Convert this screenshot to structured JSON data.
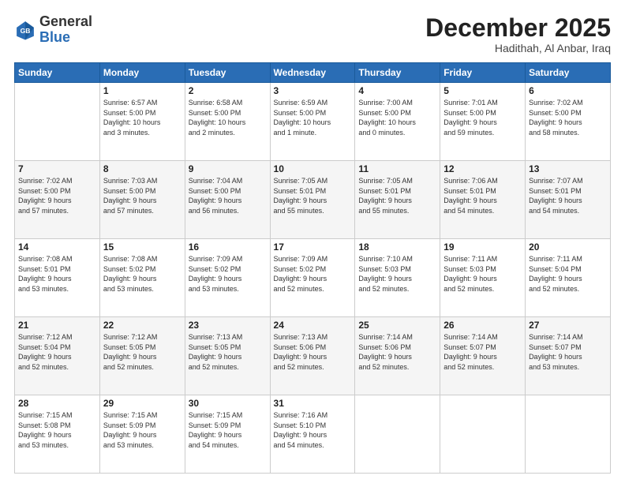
{
  "header": {
    "logo": {
      "line1": "General",
      "line2": "Blue"
    },
    "title": "December 2025",
    "location": "Hadithah, Al Anbar, Iraq"
  },
  "weekdays": [
    "Sunday",
    "Monday",
    "Tuesday",
    "Wednesday",
    "Thursday",
    "Friday",
    "Saturday"
  ],
  "weeks": [
    [
      {
        "day": "",
        "info": ""
      },
      {
        "day": "1",
        "info": "Sunrise: 6:57 AM\nSunset: 5:00 PM\nDaylight: 10 hours\nand 3 minutes."
      },
      {
        "day": "2",
        "info": "Sunrise: 6:58 AM\nSunset: 5:00 PM\nDaylight: 10 hours\nand 2 minutes."
      },
      {
        "day": "3",
        "info": "Sunrise: 6:59 AM\nSunset: 5:00 PM\nDaylight: 10 hours\nand 1 minute."
      },
      {
        "day": "4",
        "info": "Sunrise: 7:00 AM\nSunset: 5:00 PM\nDaylight: 10 hours\nand 0 minutes."
      },
      {
        "day": "5",
        "info": "Sunrise: 7:01 AM\nSunset: 5:00 PM\nDaylight: 9 hours\nand 59 minutes."
      },
      {
        "day": "6",
        "info": "Sunrise: 7:02 AM\nSunset: 5:00 PM\nDaylight: 9 hours\nand 58 minutes."
      }
    ],
    [
      {
        "day": "7",
        "info": "Sunrise: 7:02 AM\nSunset: 5:00 PM\nDaylight: 9 hours\nand 57 minutes."
      },
      {
        "day": "8",
        "info": "Sunrise: 7:03 AM\nSunset: 5:00 PM\nDaylight: 9 hours\nand 57 minutes."
      },
      {
        "day": "9",
        "info": "Sunrise: 7:04 AM\nSunset: 5:00 PM\nDaylight: 9 hours\nand 56 minutes."
      },
      {
        "day": "10",
        "info": "Sunrise: 7:05 AM\nSunset: 5:01 PM\nDaylight: 9 hours\nand 55 minutes."
      },
      {
        "day": "11",
        "info": "Sunrise: 7:05 AM\nSunset: 5:01 PM\nDaylight: 9 hours\nand 55 minutes."
      },
      {
        "day": "12",
        "info": "Sunrise: 7:06 AM\nSunset: 5:01 PM\nDaylight: 9 hours\nand 54 minutes."
      },
      {
        "day": "13",
        "info": "Sunrise: 7:07 AM\nSunset: 5:01 PM\nDaylight: 9 hours\nand 54 minutes."
      }
    ],
    [
      {
        "day": "14",
        "info": "Sunrise: 7:08 AM\nSunset: 5:01 PM\nDaylight: 9 hours\nand 53 minutes."
      },
      {
        "day": "15",
        "info": "Sunrise: 7:08 AM\nSunset: 5:02 PM\nDaylight: 9 hours\nand 53 minutes."
      },
      {
        "day": "16",
        "info": "Sunrise: 7:09 AM\nSunset: 5:02 PM\nDaylight: 9 hours\nand 53 minutes."
      },
      {
        "day": "17",
        "info": "Sunrise: 7:09 AM\nSunset: 5:02 PM\nDaylight: 9 hours\nand 52 minutes."
      },
      {
        "day": "18",
        "info": "Sunrise: 7:10 AM\nSunset: 5:03 PM\nDaylight: 9 hours\nand 52 minutes."
      },
      {
        "day": "19",
        "info": "Sunrise: 7:11 AM\nSunset: 5:03 PM\nDaylight: 9 hours\nand 52 minutes."
      },
      {
        "day": "20",
        "info": "Sunrise: 7:11 AM\nSunset: 5:04 PM\nDaylight: 9 hours\nand 52 minutes."
      }
    ],
    [
      {
        "day": "21",
        "info": "Sunrise: 7:12 AM\nSunset: 5:04 PM\nDaylight: 9 hours\nand 52 minutes."
      },
      {
        "day": "22",
        "info": "Sunrise: 7:12 AM\nSunset: 5:05 PM\nDaylight: 9 hours\nand 52 minutes."
      },
      {
        "day": "23",
        "info": "Sunrise: 7:13 AM\nSunset: 5:05 PM\nDaylight: 9 hours\nand 52 minutes."
      },
      {
        "day": "24",
        "info": "Sunrise: 7:13 AM\nSunset: 5:06 PM\nDaylight: 9 hours\nand 52 minutes."
      },
      {
        "day": "25",
        "info": "Sunrise: 7:14 AM\nSunset: 5:06 PM\nDaylight: 9 hours\nand 52 minutes."
      },
      {
        "day": "26",
        "info": "Sunrise: 7:14 AM\nSunset: 5:07 PM\nDaylight: 9 hours\nand 52 minutes."
      },
      {
        "day": "27",
        "info": "Sunrise: 7:14 AM\nSunset: 5:07 PM\nDaylight: 9 hours\nand 53 minutes."
      }
    ],
    [
      {
        "day": "28",
        "info": "Sunrise: 7:15 AM\nSunset: 5:08 PM\nDaylight: 9 hours\nand 53 minutes."
      },
      {
        "day": "29",
        "info": "Sunrise: 7:15 AM\nSunset: 5:09 PM\nDaylight: 9 hours\nand 53 minutes."
      },
      {
        "day": "30",
        "info": "Sunrise: 7:15 AM\nSunset: 5:09 PM\nDaylight: 9 hours\nand 54 minutes."
      },
      {
        "day": "31",
        "info": "Sunrise: 7:16 AM\nSunset: 5:10 PM\nDaylight: 9 hours\nand 54 minutes."
      },
      {
        "day": "",
        "info": ""
      },
      {
        "day": "",
        "info": ""
      },
      {
        "day": "",
        "info": ""
      }
    ]
  ]
}
